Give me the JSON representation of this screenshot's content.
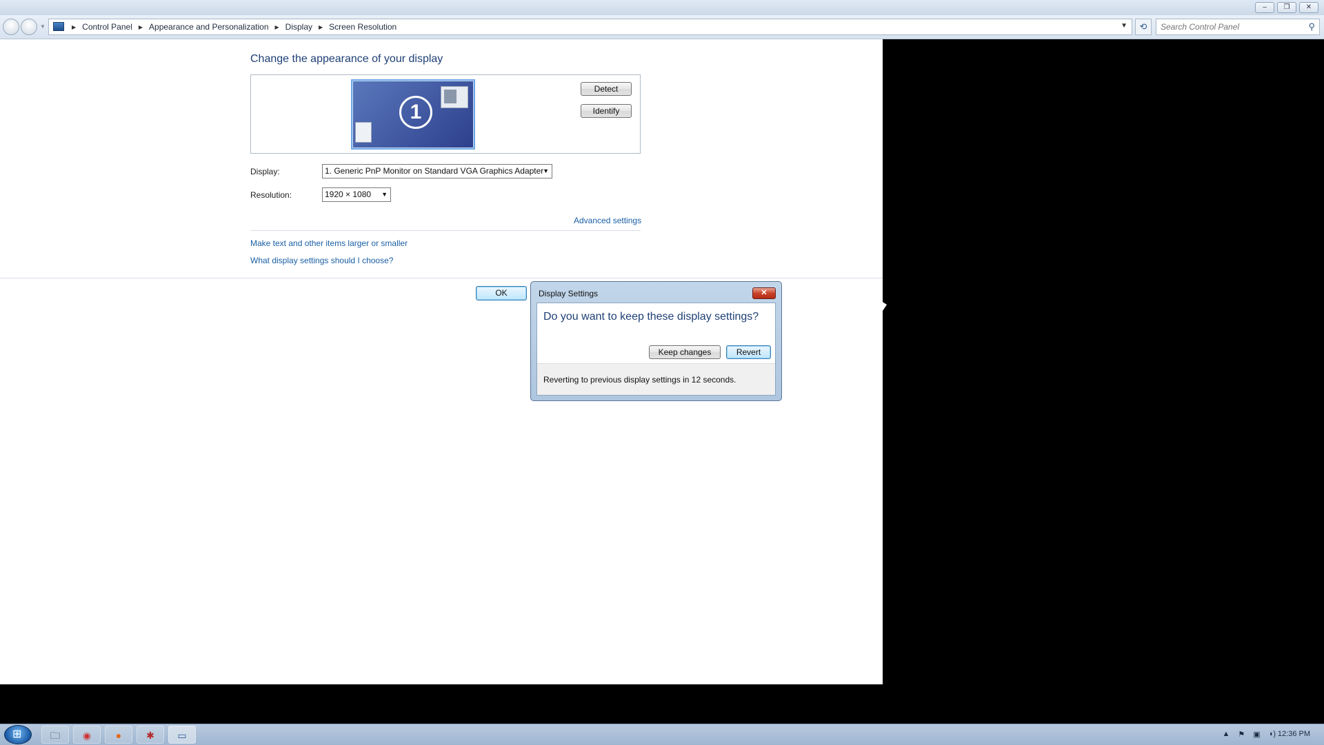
{
  "window": {
    "controls": {
      "minimize": "–",
      "restore": "❐",
      "close": "✕"
    }
  },
  "address": {
    "breadcrumbs": [
      "Control Panel",
      "Appearance and Personalization",
      "Display",
      "Screen Resolution"
    ],
    "search_placeholder": "Search Control Panel"
  },
  "main": {
    "title": "Change the appearance of your display",
    "monitor_number": "1",
    "detect_label": "Detect",
    "identify_label": "Identify",
    "display_label": "Display:",
    "display_value": "1. Generic PnP Monitor on Standard VGA Graphics Adapter",
    "resolution_label": "Resolution:",
    "resolution_value": "1920 × 1080",
    "advanced_link": "Advanced settings",
    "link_text_size": "Make text and other items larger or smaller",
    "link_which_settings": "What display settings should I choose?",
    "ok_label": "OK"
  },
  "dialog": {
    "title": "Display Settings",
    "question": "Do you want to keep these display settings?",
    "keep_label": "Keep changes",
    "revert_label": "Revert",
    "status": "Reverting to previous display settings in 12 seconds."
  },
  "taskbar": {
    "items": [
      {
        "icon": "folder-icon",
        "glyph": "🗀"
      },
      {
        "icon": "chrome-icon",
        "glyph": "◉"
      },
      {
        "icon": "firefox-icon",
        "glyph": "●"
      },
      {
        "icon": "app-icon",
        "glyph": "✱"
      },
      {
        "icon": "display-icon",
        "glyph": "▭"
      }
    ],
    "clock": "12:36 PM"
  },
  "colors": {
    "accent": "#1e3f75",
    "link": "#1a5fa5"
  }
}
